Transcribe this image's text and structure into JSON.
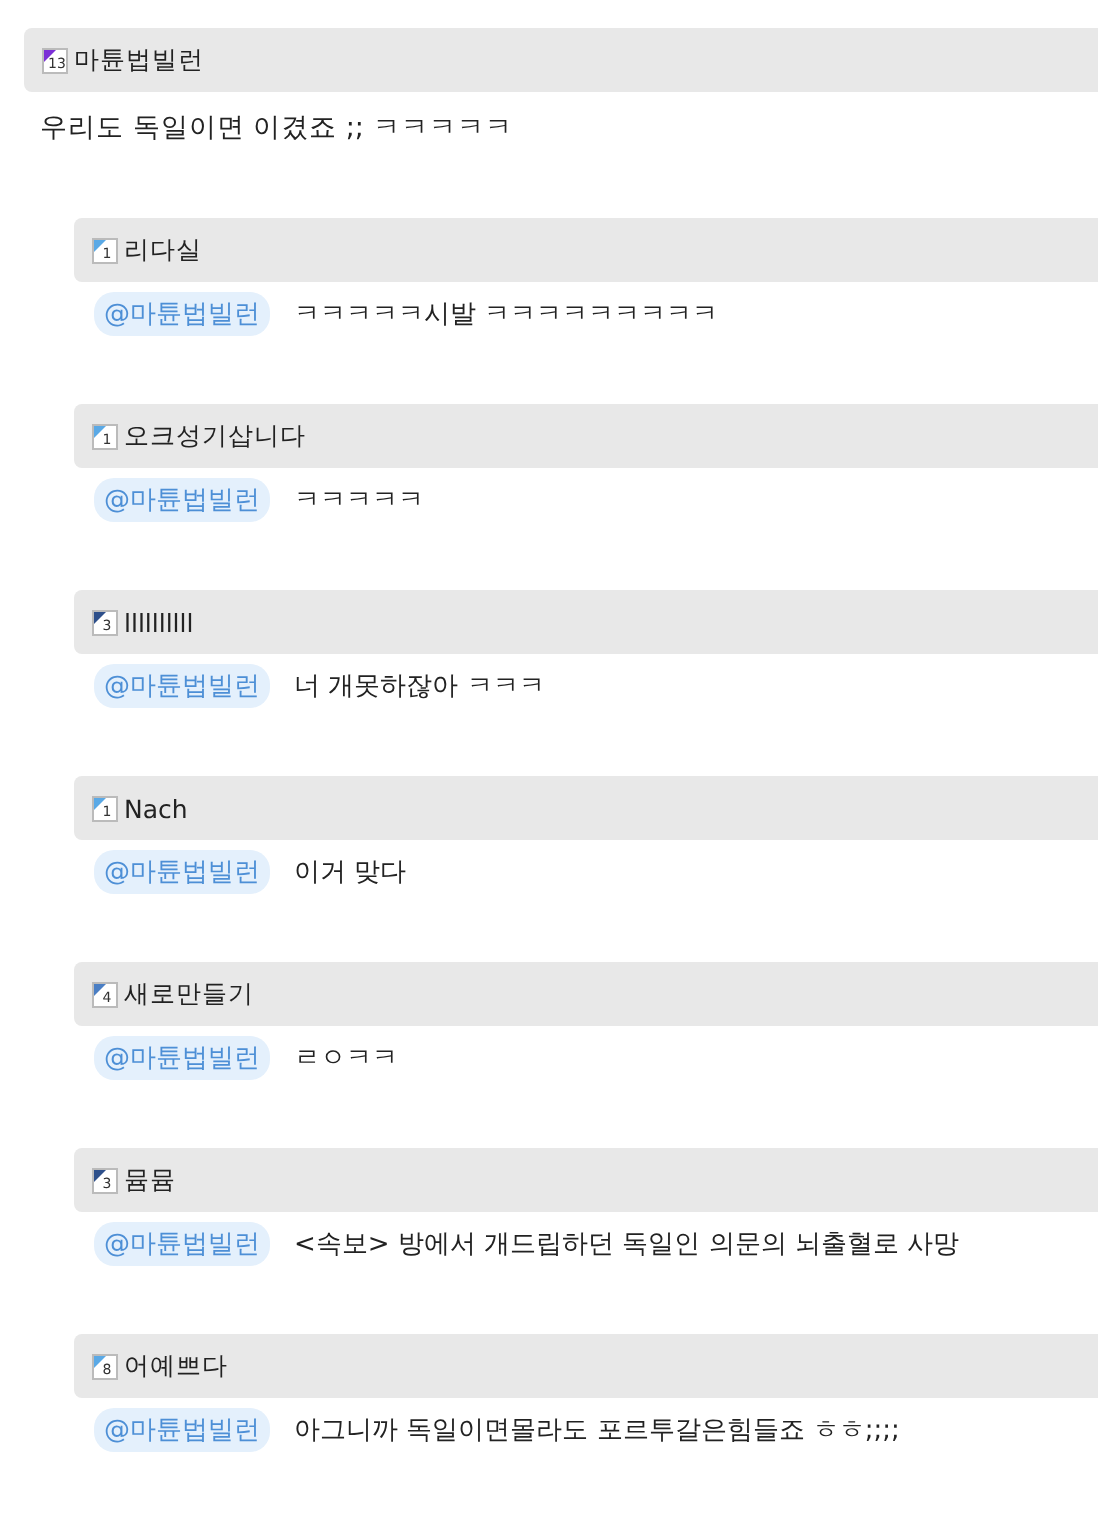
{
  "post": {
    "author": {
      "name": "마튠법빌런",
      "level": "13"
    },
    "text": "우리도 독일이면 이겼죠 ;; ㅋㅋㅋㅋㅋ"
  },
  "replies": [
    {
      "author": {
        "name": "리다실",
        "level": "1"
      },
      "mention": "@마튠법빌런",
      "text": "ㅋㅋㅋㅋㅋ시발 ㅋㅋㅋㅋㅋㅋㅋㅋㅋ"
    },
    {
      "author": {
        "name": "오크성기삽니다",
        "level": "1"
      },
      "mention": "@마튠법빌런",
      "text": "ㅋㅋㅋㅋㅋ"
    },
    {
      "author": {
        "name": "llllllllll",
        "level": "3"
      },
      "mention": "@마튠법빌런",
      "text": "너 개못하잖아 ㅋㅋㅋ"
    },
    {
      "author": {
        "name": "Nach",
        "level": "1"
      },
      "mention": "@마튠법빌런",
      "text": "이거 맞다"
    },
    {
      "author": {
        "name": "새로만들기",
        "level": "4"
      },
      "mention": "@마튠법빌런",
      "text": "ㄹㅇㅋㅋ"
    },
    {
      "author": {
        "name": "뮴뮴",
        "level": "3"
      },
      "mention": "@마튠법빌런",
      "text": "<속보> 방에서 개드립하던 독일인 의문의 뇌출혈로 사망"
    },
    {
      "author": {
        "name": "어예쁘다",
        "level": "8"
      },
      "mention": "@마튠법빌런",
      "text": "아그니까 독일이면몰라도 포르투갈은힘들죠 ㅎㅎ;;;;"
    }
  ]
}
